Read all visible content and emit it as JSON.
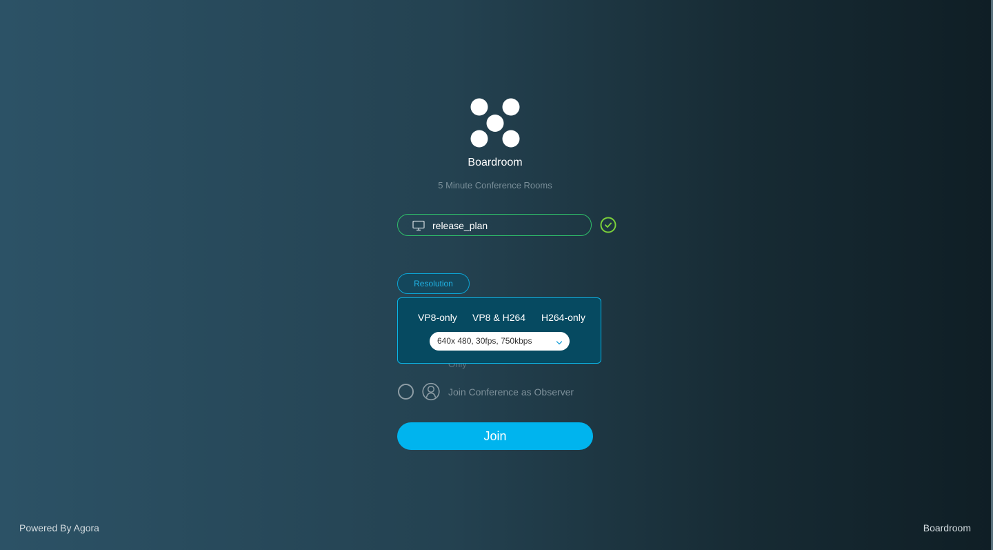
{
  "app": {
    "name": "Boardroom",
    "subtitle": "5 Minute Conference Rooms"
  },
  "channel": {
    "value": "release_plan",
    "valid": true
  },
  "resolution": {
    "label": "Resolution",
    "codecs": [
      "VP8-only",
      "VP8 & H264",
      "H264-only"
    ],
    "selected": "640x 480, 30fps, 750kbps"
  },
  "partial_option": {
    "label": "Only"
  },
  "observer": {
    "label": "Join Conference as Observer",
    "checked": false
  },
  "join": {
    "label": "Join"
  },
  "footer": {
    "left": "Powered By Agora",
    "right": "Boardroom"
  },
  "colors": {
    "accent": "#00b4ee",
    "valid": "#2fc06a",
    "popup_bg": "#064a61"
  },
  "icons": {
    "logo": "boardroom-logo-icon",
    "channel": "monitor-icon",
    "valid": "check-circle-icon",
    "observer": "user-icon",
    "select": "chevron-down-icon"
  }
}
